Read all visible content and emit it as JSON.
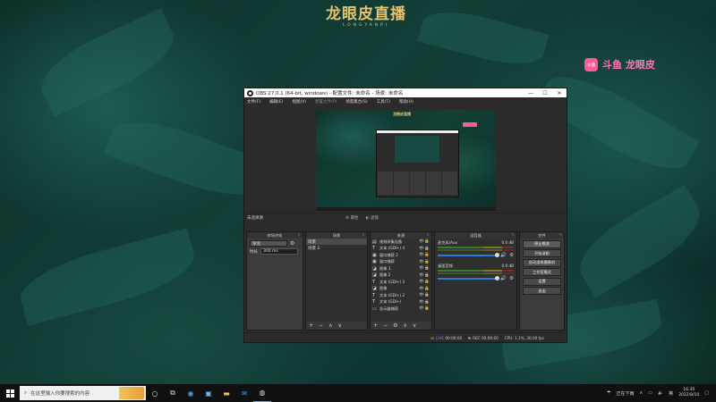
{
  "desktop": {
    "logo_title": "龙眼皮直播",
    "logo_subtitle": "LONGYANPI",
    "douyu_icon_text": "斗鱼",
    "douyu_text": "斗鱼 龙眼皮"
  },
  "obs": {
    "window_title": "OBS 27.0.1 (64-bit, windows) - 配置文件: 未命名 - 场景: 未命名",
    "menu": [
      "文件(F)",
      "编辑(E)",
      "视图(V)",
      "配置文件(P)",
      "场景集合(S)",
      "工具(T)",
      "帮助(H)"
    ],
    "scene_label": "未选择源",
    "scene_buttons": [
      "属性",
      "滤镜"
    ],
    "preview": {
      "logo": "龙眼皮直播"
    },
    "docks": {
      "transition": {
        "title": "转场特效",
        "select_value": "渐变",
        "duration_label": "时长",
        "duration_value": "300 ms"
      },
      "scenes": {
        "title": "场景",
        "items": [
          "场景",
          "场景 2"
        ]
      },
      "sources": {
        "title": "来源",
        "items": [
          {
            "icon": "▤",
            "name": "视频采集设备"
          },
          {
            "icon": "T",
            "name": "文本 (GDI+) 4"
          },
          {
            "icon": "▣",
            "name": "窗口捕获 2"
          },
          {
            "icon": "▣",
            "name": "窗口捕获"
          },
          {
            "icon": "◪",
            "name": "图像 3"
          },
          {
            "icon": "◪",
            "name": "图像 2"
          },
          {
            "icon": "T",
            "name": "文本 (GDI+) 3"
          },
          {
            "icon": "◪",
            "name": "图像"
          },
          {
            "icon": "T",
            "name": "文本 (GDI+) 2"
          },
          {
            "icon": "T",
            "name": "文本 (GDI+)"
          },
          {
            "icon": "▭",
            "name": "显示器捕获"
          }
        ]
      },
      "mixer": {
        "title": "混音器",
        "channels": [
          {
            "name": "麦克风/Aux",
            "db": "0.0 dB"
          },
          {
            "name": "桌面音频",
            "db": "0.0 dB"
          }
        ]
      },
      "controls": {
        "title": "控件",
        "buttons": [
          "停止推流",
          "开始录制",
          "启动虚拟摄像机",
          "工作室模式",
          "设置",
          "退出"
        ]
      }
    },
    "status": {
      "live_label": "LIVE",
      "live_time": "00:00:00",
      "rec_label": "REC",
      "rec_time": "00:00:00",
      "cpu": "CPU: 1.1%, 30.00 fps"
    }
  },
  "taskbar": {
    "search_placeholder": "在这里输入你要搜索的内容",
    "tray_status": "正在下雨",
    "ime": "英",
    "time": "16:30",
    "date": "2022/8/10"
  }
}
